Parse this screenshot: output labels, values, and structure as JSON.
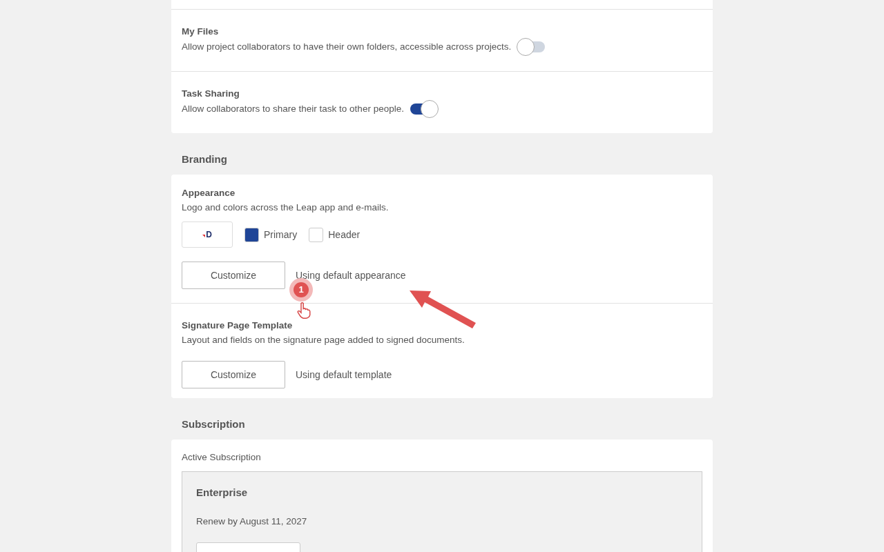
{
  "settings": [
    {
      "title": "My Files",
      "description": "Allow project collaborators to have their own folders, accessible across projects.",
      "on": false
    },
    {
      "title": "Task Sharing",
      "description": "Allow collaborators to share their task to other people.",
      "on": true
    }
  ],
  "branding": {
    "heading": "Branding",
    "items": [
      {
        "kind": "appearance",
        "title": "Appearance",
        "description": "Logo and colors across the Leap app and e-mails.",
        "logo_text": "D",
        "swatches": [
          {
            "label": "Primary",
            "color": "#1f4597"
          },
          {
            "label": "Header",
            "color": "#ffffff"
          }
        ],
        "button": "Customize",
        "status": "Using default appearance"
      },
      {
        "kind": "template",
        "title": "Signature Page Template",
        "description": "Layout and fields on the signature page added to signed documents.",
        "button": "Customize",
        "status": "Using default template"
      }
    ]
  },
  "subscription": {
    "heading": "Subscription",
    "label": "Active Subscription",
    "plan": "Enterprise",
    "renewal": "Renew by August 11, 2027"
  },
  "tutorial": {
    "step": "1"
  }
}
